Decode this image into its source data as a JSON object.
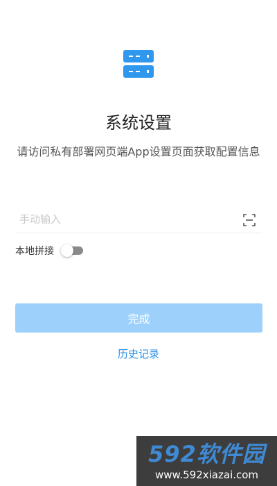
{
  "header": {
    "icon": "server-icon",
    "title": "系统设置",
    "description": "请访问私有部署网页端App设置页面获取配置信息"
  },
  "config_input": {
    "value": "",
    "placeholder": "手动输入",
    "scan_icon": "scan-icon"
  },
  "local_splice": {
    "label": "本地拼接",
    "enabled": false
  },
  "actions": {
    "done_label": "完成",
    "history_label": "历史记录"
  },
  "watermark": {
    "brand": "592软件园",
    "url": "www.592xiazai.com"
  },
  "colors": {
    "primary": "#2a8fe8",
    "primary_disabled": "#9dd1fb",
    "icon_blue": "#2f97ee",
    "toggle_off": "#8a8a8a"
  }
}
